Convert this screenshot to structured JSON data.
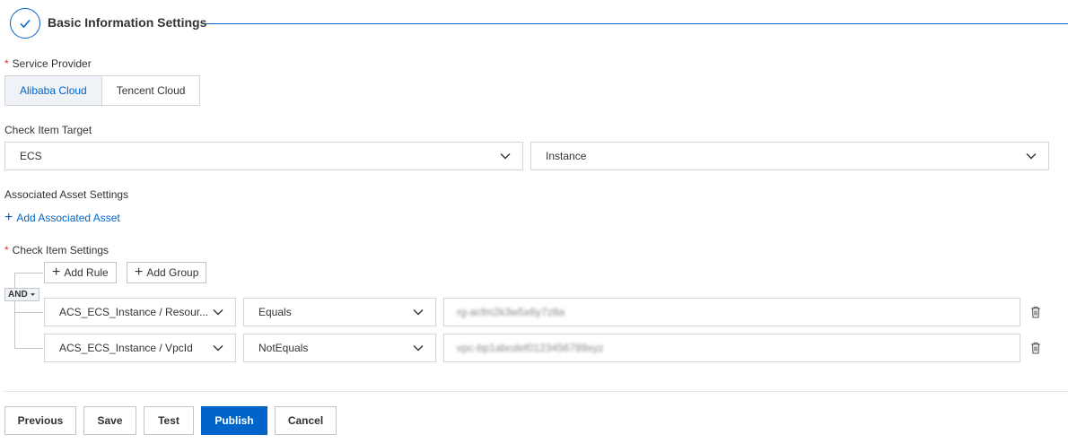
{
  "section": {
    "title": "Basic Information Settings"
  },
  "service_provider": {
    "label": "Service Provider",
    "required_mark": "*",
    "options": [
      "Alibaba Cloud",
      "Tencent Cloud"
    ],
    "selected": "Alibaba Cloud"
  },
  "check_item_target": {
    "label": "Check Item Target",
    "product": "ECS",
    "resource_type": "Instance"
  },
  "associated_assets": {
    "label": "Associated Asset Settings",
    "add_label": "Add Associated Asset"
  },
  "check_item_settings": {
    "label": "Check Item Settings",
    "required_mark": "*",
    "add_rule_label": "Add Rule",
    "add_group_label": "Add Group",
    "logic_operator": "AND",
    "rules": [
      {
        "field": "ACS_ECS_Instance / Resour...",
        "operator": "Equals",
        "value": "rg-acfm2k3w5x6y7z8a"
      },
      {
        "field": "ACS_ECS_Instance / VpcId",
        "operator": "NotEquals",
        "value": "vpc-bp1abcdef0123456789xyz"
      }
    ]
  },
  "footer": {
    "previous": "Previous",
    "save": "Save",
    "test": "Test",
    "publish": "Publish",
    "cancel": "Cancel"
  },
  "colors": {
    "primary": "#0064c8",
    "required": "#d93026",
    "border": "#d1d5db"
  }
}
